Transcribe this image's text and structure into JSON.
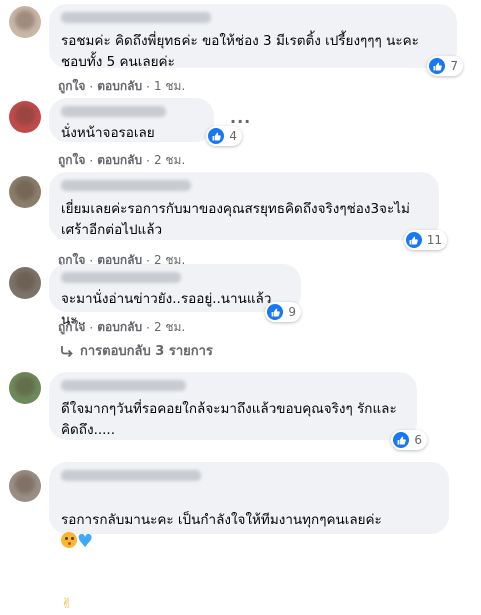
{
  "actions": {
    "like": "ถูกใจ",
    "reply": "ตอบกลับ"
  },
  "comments": [
    {
      "text": "รอชมค่ะ คิดถึงพี่ยุทธค่ะ ขอให้ช่อง 3 มีเรตติ้ง เปรี้ยงๆๆๆ นะคะ\nชอบทั้ง 5 คนเลยค่ะ",
      "likes": "7",
      "time": "1 ชม."
    },
    {
      "text": "นั่งหน้าจอรอเลย",
      "likes": "4",
      "time": "2 ชม."
    },
    {
      "text": "เยี่ยมเลยค่ะรอการกับมาของคุณสรยุทธคิดถึงจริงๆช่อง3จะไม่\nเศร้าอีกต่อไปแล้ว",
      "likes": "11",
      "time": "2 ชม."
    },
    {
      "text": "จะมานั่งอ่านข่าวยัง..รออยู่..นานแล้วนะ..",
      "likes": "9",
      "time": "2 ชม."
    },
    {
      "text": "ดีใจมากๆวันที่รอคอยใกล้จะมาถึงแล้วขอบคุณจริงๆ รักและ\nคิดถึง.....",
      "likes": "6",
      "time": ""
    },
    {
      "text": "รอการกลับมานะคะ เป็นกำลังใจให้ทีมงานทุกๆคนเลยค่ะ",
      "likes": "",
      "time": ""
    }
  ],
  "replies_link": "การตอบกลับ 3 รายการ",
  "separator": "·",
  "more_dots": "···",
  "colors": {
    "like_blue": "#1877f2",
    "bubble": "#f0f2f5",
    "meta": "#65676b"
  }
}
